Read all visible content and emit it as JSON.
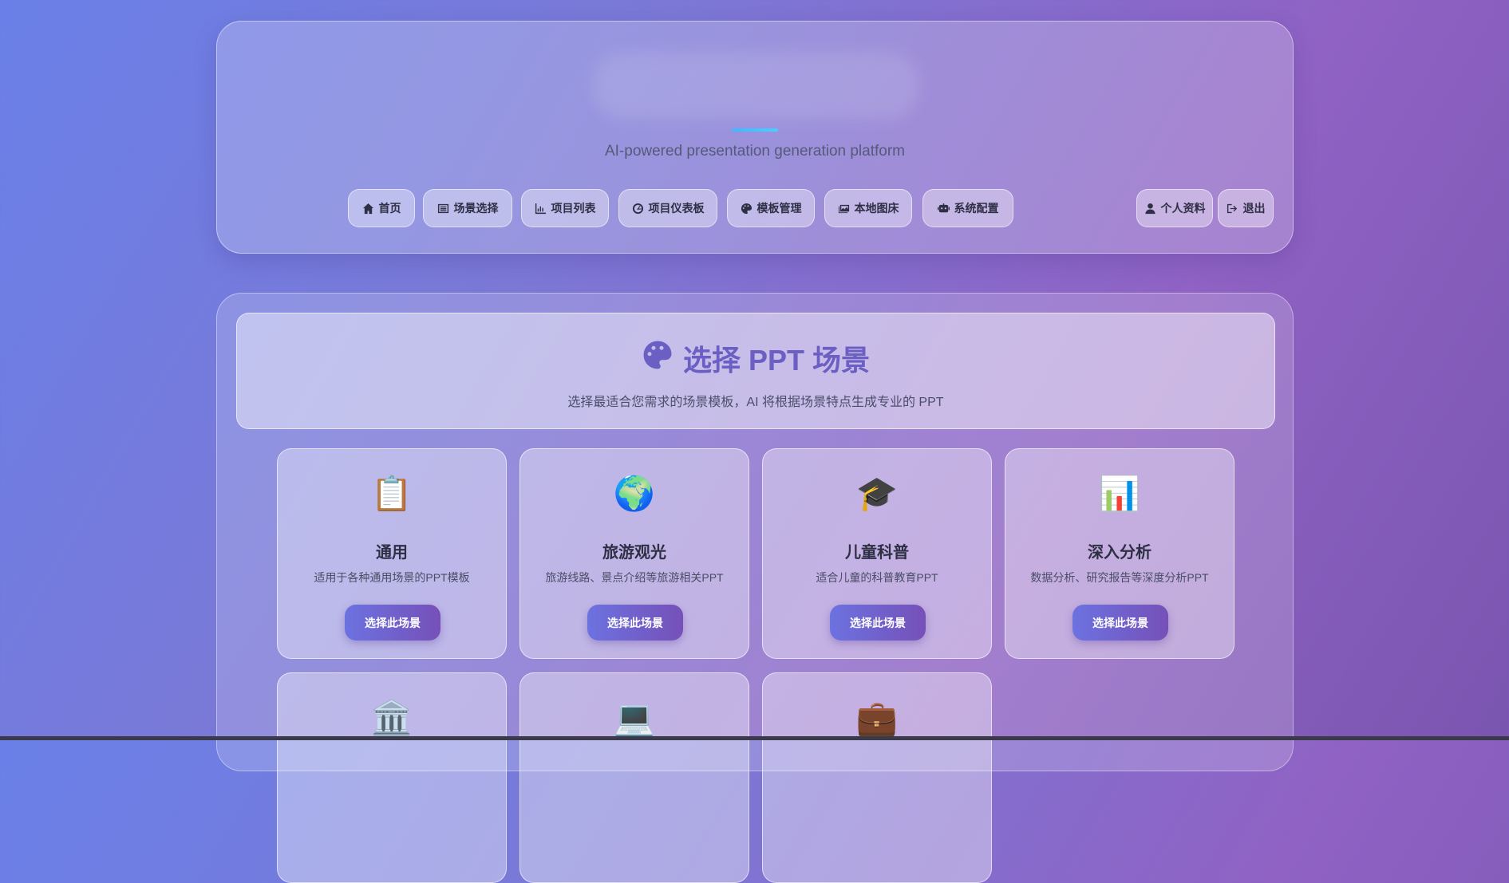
{
  "header": {
    "tagline": "AI-powered presentation generation platform",
    "nav": [
      {
        "label": "首页",
        "icon": "home-icon"
      },
      {
        "label": "场景选择",
        "icon": "list-icon"
      },
      {
        "label": "项目列表",
        "icon": "chart-icon"
      },
      {
        "label": "项目仪表板",
        "icon": "dashboard-icon"
      },
      {
        "label": "模板管理",
        "icon": "palette-icon"
      },
      {
        "label": "本地图床",
        "icon": "images-icon"
      },
      {
        "label": "系统配置",
        "icon": "robot-icon"
      }
    ],
    "user": [
      {
        "label": "个人资料",
        "icon": "user-icon"
      },
      {
        "label": "退出",
        "icon": "logout-icon"
      }
    ]
  },
  "hero": {
    "title": "选择 PPT 场景",
    "title_icon": "palette-icon",
    "subtitle": "选择最适合您需求的场景模板，AI 将根据场景特点生成专业的 PPT"
  },
  "scenes": [
    {
      "emoji": "📋",
      "icon": "clipboard-icon",
      "name": "通用",
      "desc": "适用于各种通用场景的PPT模板",
      "button": "选择此场景"
    },
    {
      "emoji": "🌍",
      "icon": "globe-icon",
      "name": "旅游观光",
      "desc": "旅游线路、景点介绍等旅游相关PPT",
      "button": "选择此场景"
    },
    {
      "emoji": "🎓",
      "icon": "graduation-cap-icon",
      "name": "儿童科普",
      "desc": "适合儿童的科普教育PPT",
      "button": "选择此场景"
    },
    {
      "emoji": "📊",
      "icon": "bar-chart-icon",
      "name": "深入分析",
      "desc": "数据分析、研究报告等深度分析PPT",
      "button": "选择此场景"
    },
    {
      "emoji": "🏛️",
      "icon": "classical-building-icon",
      "name": "",
      "desc": "",
      "button": ""
    },
    {
      "emoji": "💻",
      "icon": "laptop-icon",
      "name": "",
      "desc": "",
      "button": ""
    },
    {
      "emoji": "💼",
      "icon": "briefcase-icon",
      "name": "",
      "desc": "",
      "button": ""
    }
  ],
  "colors": {
    "accent": "#6b5fc4",
    "button_start": "#6c72e0",
    "button_end": "#7650b8",
    "line_accent": "#3fb7ff"
  }
}
